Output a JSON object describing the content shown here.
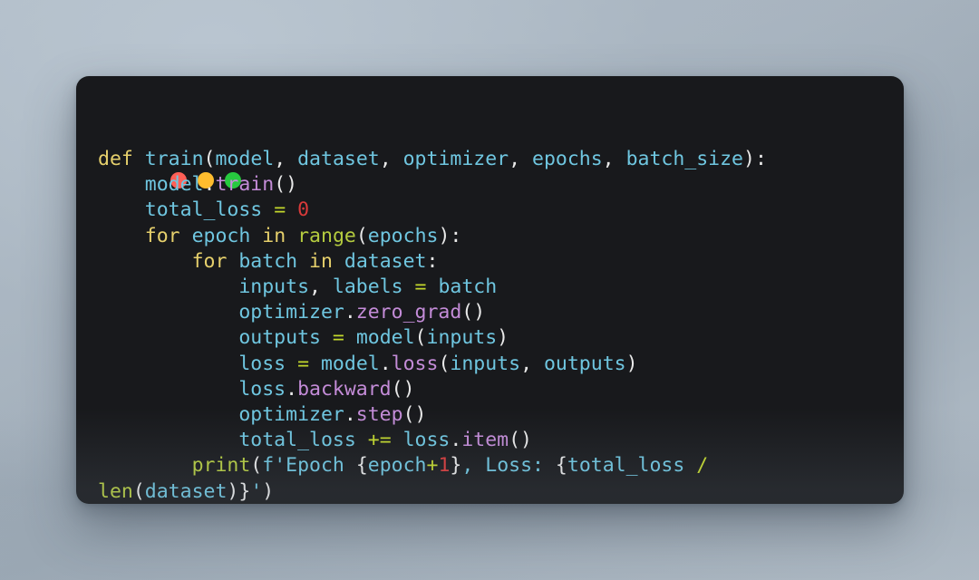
{
  "window": {
    "background_color": "#18191c",
    "desktop_gradient_from": "#b7c2cc",
    "desktop_gradient_to": "#9daab6",
    "traffic_lights": [
      {
        "name": "close",
        "color": "#ff5f56"
      },
      {
        "name": "minimize",
        "color": "#ffbd2e"
      },
      {
        "name": "maximize",
        "color": "#27c93f"
      }
    ]
  },
  "palette": {
    "keyword": "#e6d06c",
    "identifier": "#6fc6e0",
    "attribute": "#c48cd8",
    "builtin": "#b5cc3f",
    "operator": "#c3d82c",
    "number": "#d93a3a",
    "string": "#6fc6e0",
    "punctuation": "#e9e9e9",
    "foreground": "#e6e6e6"
  },
  "code": {
    "language": "python",
    "plain_text": "def train(model, dataset, optimizer, epochs, batch_size):\n    model.train()\n    total_loss = 0\n    for epoch in range(epochs):\n        for batch in dataset:\n            inputs, labels = batch\n            optimizer.zero_grad()\n            outputs = model(inputs)\n            loss = model.loss(inputs, outputs)\n            loss.backward()\n            optimizer.step()\n            total_loss += loss.item()\n        print(f'Epoch {epoch+1}, Loss: {total_loss / len(dataset)}')",
    "lines": [
      {
        "indent": 0,
        "tokens": [
          {
            "t": "def",
            "c": "kw"
          },
          {
            "t": " ",
            "c": "pun"
          },
          {
            "t": "train",
            "c": "fn"
          },
          {
            "t": "(",
            "c": "pun"
          },
          {
            "t": "model",
            "c": "id"
          },
          {
            "t": ", ",
            "c": "pun"
          },
          {
            "t": "dataset",
            "c": "id"
          },
          {
            "t": ", ",
            "c": "pun"
          },
          {
            "t": "optimizer",
            "c": "id"
          },
          {
            "t": ", ",
            "c": "pun"
          },
          {
            "t": "epochs",
            "c": "id"
          },
          {
            "t": ", ",
            "c": "pun"
          },
          {
            "t": "batch_size",
            "c": "id"
          },
          {
            "t": "):",
            "c": "pun"
          }
        ]
      },
      {
        "indent": 4,
        "tokens": [
          {
            "t": "model",
            "c": "id"
          },
          {
            "t": ".",
            "c": "pun"
          },
          {
            "t": "train",
            "c": "attr"
          },
          {
            "t": "()",
            "c": "pun"
          }
        ]
      },
      {
        "indent": 4,
        "tokens": [
          {
            "t": "total_loss",
            "c": "id"
          },
          {
            "t": " ",
            "c": "pun"
          },
          {
            "t": "=",
            "c": "op"
          },
          {
            "t": " ",
            "c": "pun"
          },
          {
            "t": "0",
            "c": "num"
          }
        ]
      },
      {
        "indent": 4,
        "tokens": [
          {
            "t": "for",
            "c": "kw"
          },
          {
            "t": " ",
            "c": "pun"
          },
          {
            "t": "epoch",
            "c": "id"
          },
          {
            "t": " ",
            "c": "pun"
          },
          {
            "t": "in",
            "c": "kw"
          },
          {
            "t": " ",
            "c": "pun"
          },
          {
            "t": "range",
            "c": "bi"
          },
          {
            "t": "(",
            "c": "pun"
          },
          {
            "t": "epochs",
            "c": "id"
          },
          {
            "t": "):",
            "c": "pun"
          }
        ]
      },
      {
        "indent": 8,
        "tokens": [
          {
            "t": "for",
            "c": "kw"
          },
          {
            "t": " ",
            "c": "pun"
          },
          {
            "t": "batch",
            "c": "id"
          },
          {
            "t": " ",
            "c": "pun"
          },
          {
            "t": "in",
            "c": "kw"
          },
          {
            "t": " ",
            "c": "pun"
          },
          {
            "t": "dataset",
            "c": "id"
          },
          {
            "t": ":",
            "c": "pun"
          }
        ]
      },
      {
        "indent": 12,
        "tokens": [
          {
            "t": "inputs",
            "c": "id"
          },
          {
            "t": ", ",
            "c": "pun"
          },
          {
            "t": "labels",
            "c": "id"
          },
          {
            "t": " ",
            "c": "pun"
          },
          {
            "t": "=",
            "c": "op"
          },
          {
            "t": " ",
            "c": "pun"
          },
          {
            "t": "batch",
            "c": "id"
          }
        ]
      },
      {
        "indent": 12,
        "tokens": [
          {
            "t": "optimizer",
            "c": "id"
          },
          {
            "t": ".",
            "c": "pun"
          },
          {
            "t": "zero_grad",
            "c": "attr"
          },
          {
            "t": "()",
            "c": "pun"
          }
        ]
      },
      {
        "indent": 12,
        "tokens": [
          {
            "t": "outputs",
            "c": "id"
          },
          {
            "t": " ",
            "c": "pun"
          },
          {
            "t": "=",
            "c": "op"
          },
          {
            "t": " ",
            "c": "pun"
          },
          {
            "t": "model",
            "c": "id"
          },
          {
            "t": "(",
            "c": "pun"
          },
          {
            "t": "inputs",
            "c": "id"
          },
          {
            "t": ")",
            "c": "pun"
          }
        ]
      },
      {
        "indent": 12,
        "tokens": [
          {
            "t": "loss",
            "c": "id"
          },
          {
            "t": " ",
            "c": "pun"
          },
          {
            "t": "=",
            "c": "op"
          },
          {
            "t": " ",
            "c": "pun"
          },
          {
            "t": "model",
            "c": "id"
          },
          {
            "t": ".",
            "c": "pun"
          },
          {
            "t": "loss",
            "c": "attr"
          },
          {
            "t": "(",
            "c": "pun"
          },
          {
            "t": "inputs",
            "c": "id"
          },
          {
            "t": ", ",
            "c": "pun"
          },
          {
            "t": "outputs",
            "c": "id"
          },
          {
            "t": ")",
            "c": "pun"
          }
        ]
      },
      {
        "indent": 12,
        "tokens": [
          {
            "t": "loss",
            "c": "id"
          },
          {
            "t": ".",
            "c": "pun"
          },
          {
            "t": "backward",
            "c": "attr"
          },
          {
            "t": "()",
            "c": "pun"
          }
        ]
      },
      {
        "indent": 12,
        "tokens": [
          {
            "t": "optimizer",
            "c": "id"
          },
          {
            "t": ".",
            "c": "pun"
          },
          {
            "t": "step",
            "c": "attr"
          },
          {
            "t": "()",
            "c": "pun"
          }
        ]
      },
      {
        "indent": 12,
        "tokens": [
          {
            "t": "total_loss",
            "c": "id"
          },
          {
            "t": " ",
            "c": "pun"
          },
          {
            "t": "+=",
            "c": "op"
          },
          {
            "t": " ",
            "c": "pun"
          },
          {
            "t": "loss",
            "c": "id"
          },
          {
            "t": ".",
            "c": "pun"
          },
          {
            "t": "item",
            "c": "attr"
          },
          {
            "t": "()",
            "c": "pun"
          }
        ]
      },
      {
        "indent": 8,
        "tokens": [
          {
            "t": "print",
            "c": "bi"
          },
          {
            "t": "(",
            "c": "pun"
          },
          {
            "t": "f'",
            "c": "str"
          },
          {
            "t": "Epoch ",
            "c": "str"
          },
          {
            "t": "{",
            "c": "pun"
          },
          {
            "t": "epoch",
            "c": "id"
          },
          {
            "t": "+",
            "c": "op"
          },
          {
            "t": "1",
            "c": "num"
          },
          {
            "t": "}",
            "c": "pun"
          },
          {
            "t": ", Loss: ",
            "c": "str"
          },
          {
            "t": "{",
            "c": "pun"
          },
          {
            "t": "total_loss",
            "c": "id"
          },
          {
            "t": " ",
            "c": "pun"
          },
          {
            "t": "/",
            "c": "op"
          }
        ]
      },
      {
        "indent": 0,
        "wrapped": true,
        "tokens": [
          {
            "t": "len",
            "c": "bi"
          },
          {
            "t": "(",
            "c": "pun"
          },
          {
            "t": "dataset",
            "c": "id"
          },
          {
            "t": ")",
            "c": "pun"
          },
          {
            "t": "}",
            "c": "pun"
          },
          {
            "t": "'",
            "c": "str"
          },
          {
            "t": ")",
            "c": "pun"
          }
        ]
      }
    ]
  }
}
